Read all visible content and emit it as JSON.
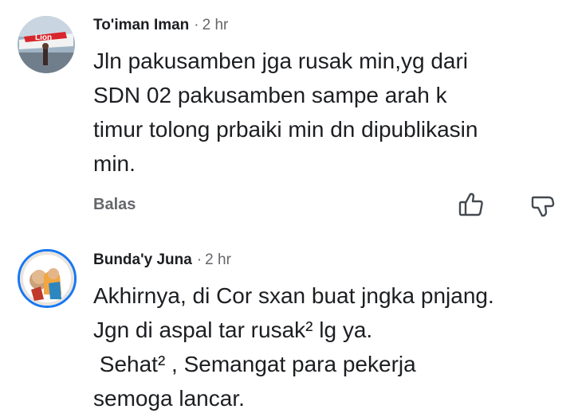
{
  "comments": [
    {
      "author": "To'iman Iman",
      "separator": "·",
      "time": "2 hr",
      "avatar_icon": "airplane-avatar-icon",
      "text_lines": [
        "Jln pakusamben jga rusak min,yg dari",
        "SDN 02 pakusamben sampe arah k",
        "timur tolong prbaiki min dn dipublikasin",
        "min."
      ],
      "avatar_banner_text": "Lion",
      "reply_label": "Balas",
      "like_icon": "thumbs-up-icon",
      "dislike_icon": "thumbs-down-icon"
    },
    {
      "author": "Bunda'y Juna",
      "separator": "·",
      "time": "2 hr",
      "avatar_icon": "person-avatar-icon",
      "text_lines": [
        "Akhirnya, di Cor sxan buat jngka pnjang.",
        "Jgn di aspal tar rusak² lg ya.",
        " Sehat² , Semangat para pekerja",
        "semoga lancar."
      ]
    }
  ],
  "colors": {
    "author": "#1c1e21",
    "secondary": "#65676b",
    "avatar_ring": "#1877f2",
    "background": "#ffffff"
  }
}
